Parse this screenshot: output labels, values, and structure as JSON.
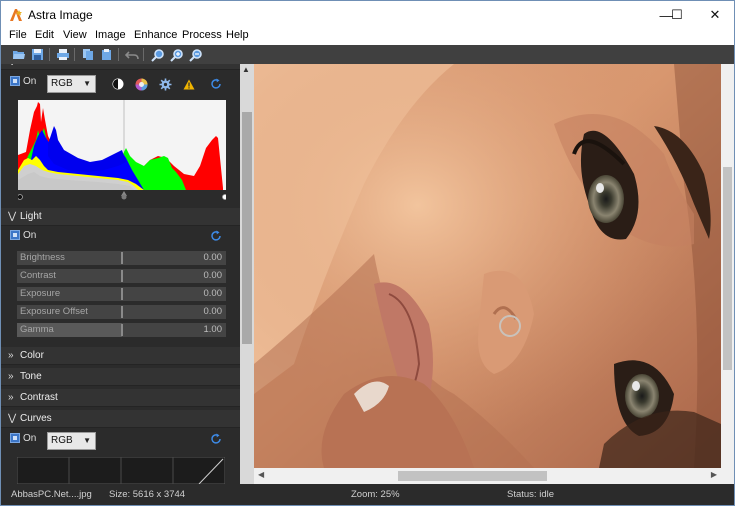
{
  "window": {
    "title": "Astra Image",
    "controls": {
      "minimize": "—",
      "maximize": "☐",
      "close": "✕"
    }
  },
  "menu": [
    "File",
    "Edit",
    "View",
    "Image",
    "Enhance",
    "Process",
    "Help"
  ],
  "toolbar": {
    "icons": [
      "open-folder-icon",
      "save-icon",
      "print-icon",
      "copy-icon",
      "paste-icon",
      "undo-icon",
      "zoom-fit-icon",
      "zoom-in-icon",
      "zoom-out-icon"
    ]
  },
  "levels": {
    "on_label": "On",
    "channel": "RGB",
    "icons": [
      "contrast-circle-icon",
      "color-wheel-icon",
      "gear-icon",
      "warning-icon",
      "reset-icon"
    ]
  },
  "light": {
    "title": "Light",
    "on_label": "On",
    "sliders": [
      {
        "label": "Brightness",
        "value": "0.00",
        "level": 0.5
      },
      {
        "label": "Contrast",
        "value": "0.00",
        "level": 0.5
      },
      {
        "label": "Exposure",
        "value": "0.00",
        "level": 0.5
      },
      {
        "label": "Exposure Offset",
        "value": "0.00",
        "level": 0.5
      },
      {
        "label": "Gamma",
        "value": "1.00",
        "level": 0.5
      }
    ]
  },
  "sections": [
    {
      "title": "Color"
    },
    {
      "title": "Tone"
    },
    {
      "title": "Contrast"
    }
  ],
  "curves": {
    "title": "Curves",
    "on_label": "On",
    "channel": "RGB"
  },
  "status": {
    "file": "AbbasPC.Net....jpg",
    "size": "Size: 5616 x 3744",
    "zoom": "Zoom: 25%",
    "state": "Status: idle"
  },
  "colors": {
    "panel_bg": "#2b2b2b",
    "toolbar_bg": "#404040",
    "accent": "#3c76c8"
  }
}
